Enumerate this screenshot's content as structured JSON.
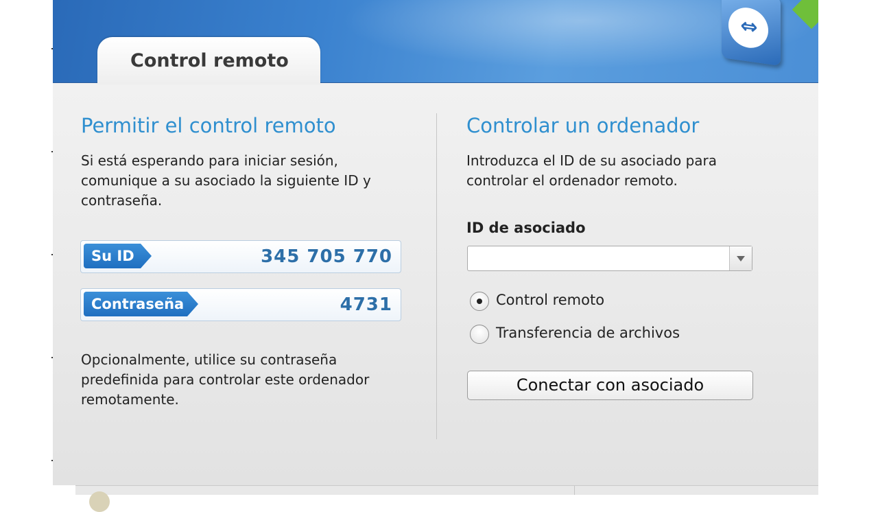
{
  "header": {
    "tab_label": "Control remoto"
  },
  "left": {
    "title": "Permitir el control remoto",
    "intro": "Si está esperando para iniciar sesión, comunique a su asociado la siguiente ID y contraseña.",
    "id_label": "Su ID",
    "id_value": "345 705 770",
    "password_label": "Contraseña",
    "password_value": "4731",
    "footnote": "Opcionalmente, utilice su contraseña predefinida para controlar este ordenador remotamente."
  },
  "right": {
    "title": "Controlar un ordenador",
    "intro": "Introduzca el ID de su asociado para controlar el ordenador remoto.",
    "partner_id_label": "ID de asociado",
    "partner_id_value": "",
    "options": [
      {
        "label": "Control remoto",
        "selected": true
      },
      {
        "label": "Transferencia de archivos",
        "selected": false
      }
    ],
    "connect_label": "Conectar con asociado"
  },
  "colors": {
    "accent_blue": "#2f8fcf",
    "header_blue": "#3b82cf",
    "pill_blue": "#1f6fc0",
    "logo_green": "#6fbf3a"
  }
}
